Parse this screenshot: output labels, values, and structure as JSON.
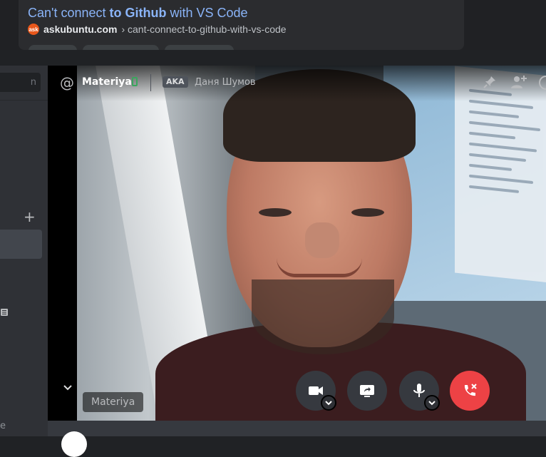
{
  "search_result": {
    "title_prefix": "Can't connect ",
    "title_bold": "to Github",
    "title_suffix": " with VS Code",
    "favicon": "ask",
    "domain": "askubuntu.com",
    "breadcrumb": " › cant-connect-to-github-with-vs-code"
  },
  "left_panel": {
    "find_text": "n",
    "add_icon": "plus-icon",
    "footer_text": "e"
  },
  "call": {
    "icon": "at-icon",
    "username": "Materiya",
    "status_icon": "mobile-icon",
    "aka_label": "AKA",
    "aka_name": "Даня Шумов",
    "header_actions": [
      "pin-icon",
      "add-user-icon",
      "avatar"
    ],
    "participant_label": "Materiya",
    "controls": [
      "camera-icon",
      "screen-share-icon",
      "microphone-icon",
      "end-call-icon"
    ]
  },
  "colors": {
    "link_blue": "#8ab4f8",
    "online_green": "#3ba55d",
    "end_call_red": "#ed4245",
    "discord_dark": "#202225"
  }
}
